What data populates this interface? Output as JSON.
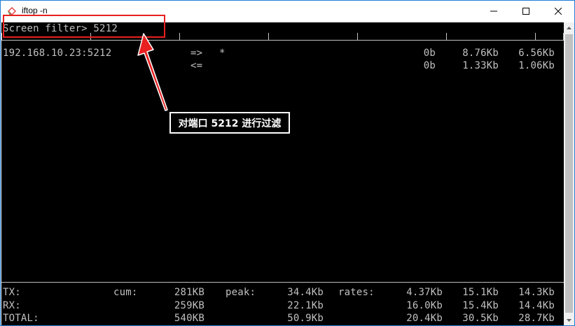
{
  "window": {
    "title": "iftop -n",
    "colors": {
      "terminal_bg": "#000000",
      "terminal_fg": "#c0c0c0",
      "annotation": "#e8201f",
      "border": "#1e7fd6"
    }
  },
  "terminal": {
    "filter_prompt": "Screen filter> 5212",
    "scale_ticks": 8,
    "host": {
      "address": "192.168.10.23:5212",
      "out": {
        "dir": "=>",
        "peer": "*",
        "c1": "0b",
        "c2": "8.76Kb",
        "c3": "6.56Kb"
      },
      "in": {
        "dir": "<=",
        "peer": "",
        "c1": "0b",
        "c2": "1.33Kb",
        "c3": "1.06Kb"
      }
    },
    "totals": [
      {
        "label": "TX:",
        "cum_label": "cum:",
        "cum": "281KB",
        "peak_label": "peak:",
        "peak": "34.4Kb",
        "rates_label": "rates:",
        "r1": "4.37Kb",
        "r2": "15.1Kb",
        "r3": "14.3Kb"
      },
      {
        "label": "RX:",
        "cum_label": "",
        "cum": "259KB",
        "peak_label": "",
        "peak": "22.1Kb",
        "rates_label": "",
        "r1": "16.0Kb",
        "r2": "15.4Kb",
        "r3": "14.4Kb"
      },
      {
        "label": "TOTAL:",
        "cum_label": "",
        "cum": "540KB",
        "peak_label": "",
        "peak": "50.9Kb",
        "rates_label": "",
        "r1": "20.4Kb",
        "r2": "30.5Kb",
        "r3": "28.7Kb"
      }
    ]
  },
  "annotation": {
    "callout_text": "对端口 5212 进行过滤"
  },
  "icons": {
    "app": "iftop-app-icon",
    "minimize": "minimize-icon",
    "maximize": "maximize-icon",
    "close": "close-icon"
  }
}
